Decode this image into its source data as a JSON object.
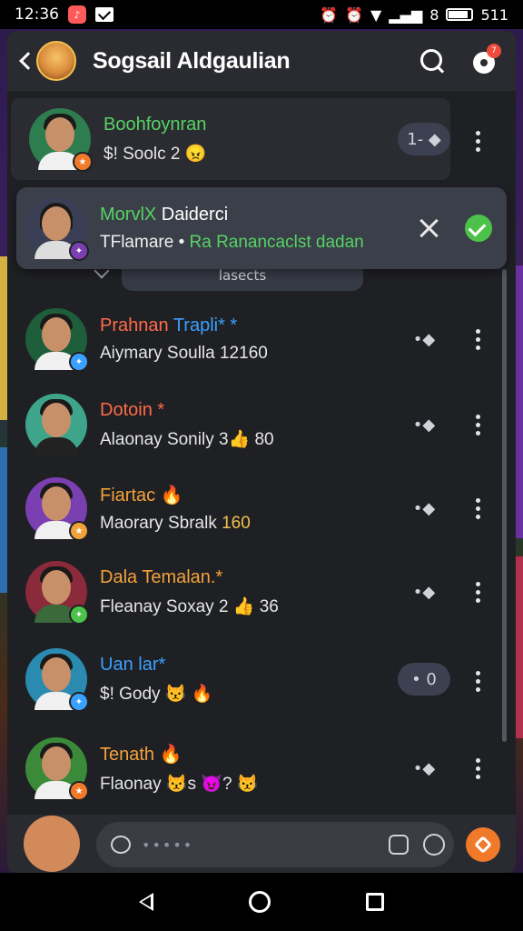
{
  "status_bar": {
    "time": "12:36",
    "network": "511",
    "network_prefix": "8"
  },
  "header": {
    "title": "Sogsail Aldgaulian",
    "gear_badge": "7"
  },
  "rows": [
    {
      "name": "Boohfoynran",
      "name_color": "#56d364",
      "sub": "$! Soolc 2 😠",
      "sub_highlight": "",
      "action": "1- ◆",
      "action_style": "pill",
      "avatar_bg": "#2e7d4f",
      "badge_color": "#f07a2a",
      "badge": "★"
    },
    {
      "name": "Prahnan",
      "name_extra": "Trapli* *",
      "name_color": "#ff6b4a",
      "extra_color": "#3aa0ff",
      "sub": "Aiymary Soulla 12160",
      "sub_highlight": "",
      "action": "•◆",
      "action_style": "plain",
      "avatar_bg": "#1f5e3a",
      "badge_color": "#3aa0ff",
      "badge": "✦"
    },
    {
      "name": "Dotoin *",
      "name_color": "#ff6b4a",
      "sub": "Alaonay Sonily 3👍 80",
      "sub_highlight": "",
      "action": "•◆",
      "action_style": "plain",
      "avatar_bg": "#3fa58a",
      "badge_color": "",
      "badge": ""
    },
    {
      "name": "Fiartac 🔥",
      "name_color": "#f2a23a",
      "sub": "Maorary Sbralk ",
      "sub_highlight": "160",
      "action": "•◆",
      "action_style": "plain",
      "avatar_bg": "#7a3fb0",
      "badge_color": "#f2a23a",
      "badge": "★"
    },
    {
      "name": "Dala Temalan.*",
      "name_color": "#f2a23a",
      "sub": "Fleanay Soxay 2 👍 36",
      "sub_highlight": "",
      "action": "•◆",
      "action_style": "plain",
      "avatar_bg": "#8a2a3a",
      "badge_color": "#4cc24a",
      "badge": "✦"
    },
    {
      "name": "Uan lar*",
      "name_color": "#3aa0ff",
      "sub": "$! Gody 😾 🔥",
      "sub_highlight": "",
      "action": "• 0",
      "action_style": "pill",
      "avatar_bg": "#2a8ab0",
      "badge_color": "#3aa0ff",
      "badge": "✦"
    },
    {
      "name": "Tenath 🔥",
      "name_color": "#f2a23a",
      "sub": "Flaonay 😾s 😈? 😾",
      "sub_highlight": "",
      "action": "•◆",
      "action_style": "plain",
      "avatar_bg": "#3a8a3a",
      "badge_color": "#f07a2a",
      "badge": "★"
    }
  ],
  "selected": {
    "name_green": "MorvlX",
    "name_white": "Daiderci",
    "sub_white": "TFlamare • ",
    "sub_green": "Ra Ranancaclst dadan",
    "tooltip": "lasects"
  },
  "composer": {
    "placeholder": "•••••"
  },
  "colors": {
    "panel": "#1f2024",
    "header": "#2a2b30",
    "accent_orange": "#f07a2a",
    "accent_green": "#4cc24a"
  }
}
